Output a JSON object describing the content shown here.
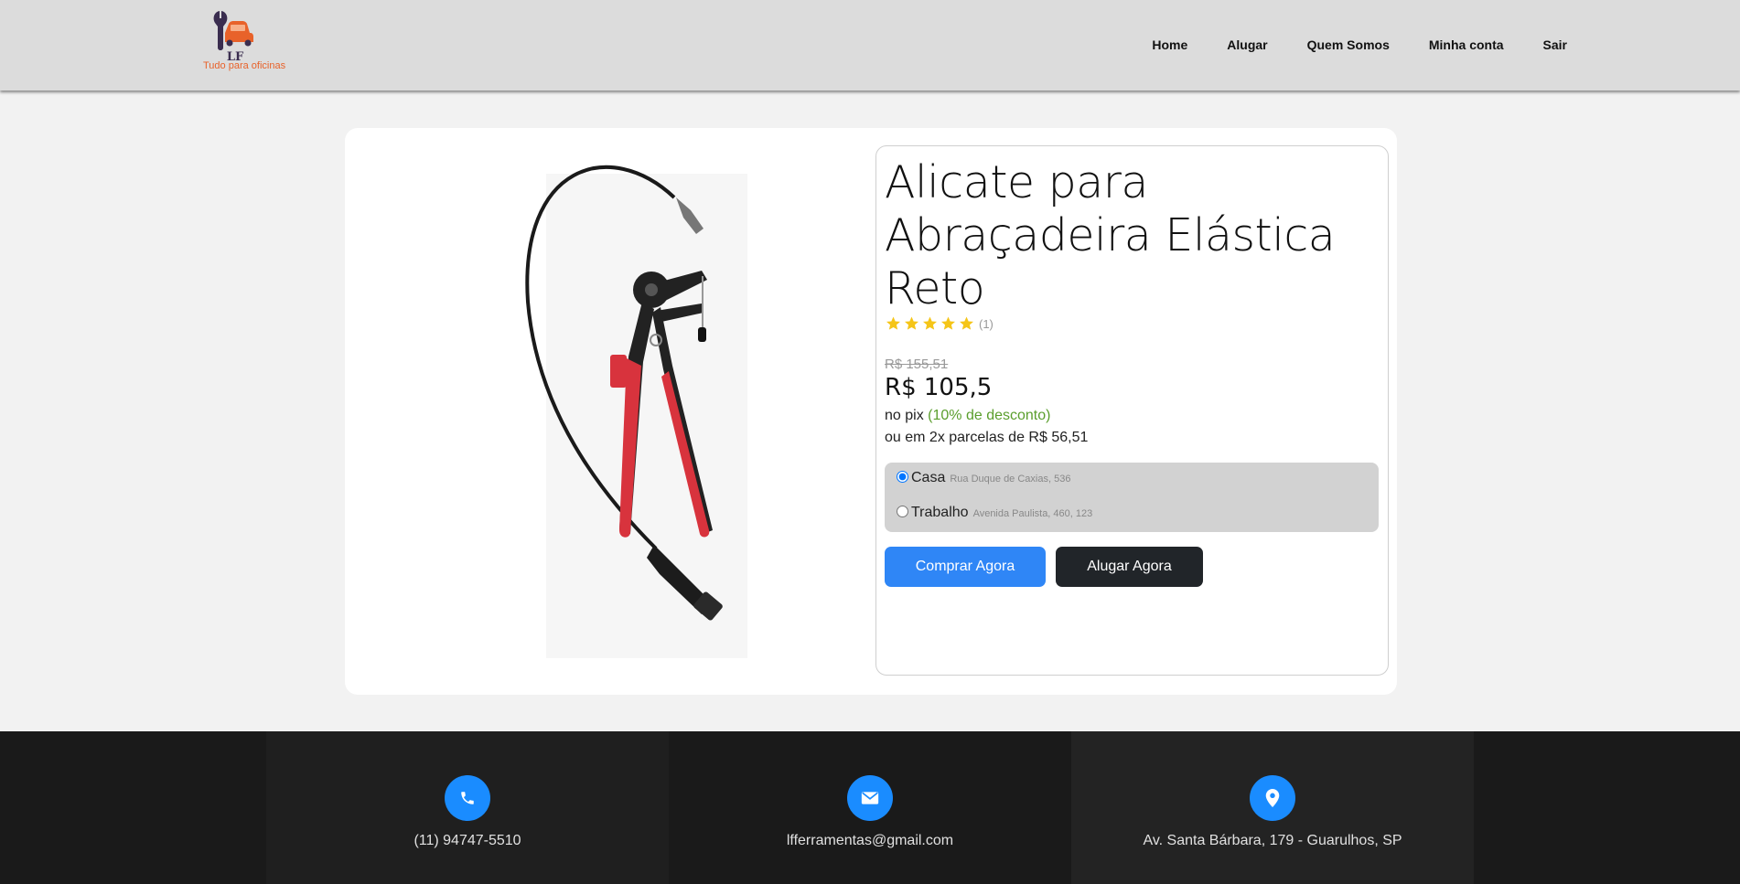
{
  "header": {
    "logo_letters": "LF",
    "logo_tagline": "Tudo para oficinas",
    "nav": [
      "Home",
      "Alugar",
      "Quem Somos",
      "Minha conta",
      "Sair"
    ]
  },
  "product": {
    "title": "Alicate para Abraçadeira Elástica Reto",
    "rating_stars": 5,
    "rating_count": "(1)",
    "price_old": "R$ 155,51",
    "price": "R$ 105,5",
    "pix_label": "no pix",
    "pix_discount": "(10% de desconto)",
    "installments": "ou em 2x parcelas de R$ 56,51",
    "addresses": [
      {
        "label": "Casa",
        "street": "Rua Duque de Caxias, 536",
        "selected": true
      },
      {
        "label": "Trabalho",
        "street": "Avenida Paulista, 460, 123",
        "selected": false
      }
    ],
    "buy_label": "Comprar Agora",
    "rent_label": "Alugar Agora"
  },
  "footer": {
    "phone": "(11) 94747-5510",
    "email": "lfferramentas@gmail.com",
    "address": "Av. Santa Bárbara, 179 - Guarulhos, SP"
  },
  "colors": {
    "accent_blue": "#2f86f6",
    "dark_button": "#212529",
    "discount_green": "#5a9e2c",
    "star_yellow": "#f5c518",
    "logo_orange": "#e8622a",
    "logo_purple": "#3a2d4f"
  },
  "icons": {
    "phone": "phone-icon",
    "email": "email-icon",
    "location": "location-pin-icon",
    "star": "star-icon"
  }
}
